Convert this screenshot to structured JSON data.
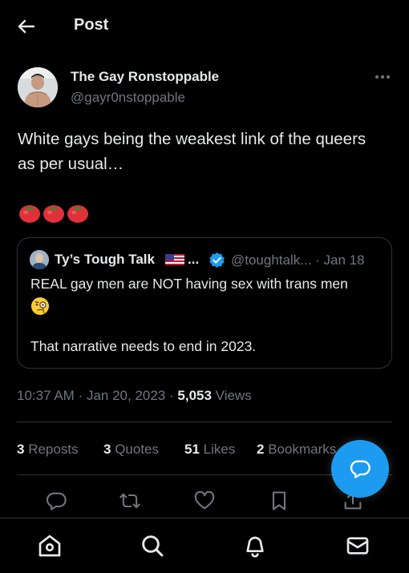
{
  "header": {
    "title": "Post",
    "back_icon": "arrow-left-icon"
  },
  "author": {
    "name": "The Gay Ronstoppable",
    "handle": "@gayr0nstoppable",
    "more_icon": "more-horizontal-icon"
  },
  "tweet": {
    "text": "White gays being the weakest link of the queers as per usual…",
    "emoji": "🍅🍅🍅"
  },
  "quote": {
    "name": "Ty’s Tough Talk",
    "flag_icon": "us-flag-icon",
    "name_ellipsis": "...",
    "verified_icon": "verified-badge-icon",
    "handle_date": "@toughtalk... · Jan 18",
    "text_line1": "REAL gay men are NOT having sex with trans men",
    "text_emoji": "🧐",
    "text_line2": "That narrative needs to end in 2023."
  },
  "meta": {
    "time": "10:37 AM",
    "date": "Jan 20, 2023",
    "views_count": "5,053",
    "views_label": "Views"
  },
  "stats": {
    "reposts_count": "3",
    "reposts_label": "Reposts",
    "quotes_count": "3",
    "quotes_label": "Quotes",
    "likes_count": "51",
    "likes_label": "Likes",
    "bookmarks_count": "2",
    "bookmarks_label": "Bookmarks"
  },
  "actions": [
    "reply-icon",
    "repost-icon",
    "like-icon",
    "bookmark-icon",
    "share-icon"
  ],
  "nav": [
    "home-icon",
    "search-icon",
    "notifications-icon",
    "messages-icon"
  ],
  "colors": {
    "background": "#000000",
    "text": "#e7e9ea",
    "muted": "#71767b",
    "accent": "#1d9bf0",
    "border": "#2f3336"
  }
}
